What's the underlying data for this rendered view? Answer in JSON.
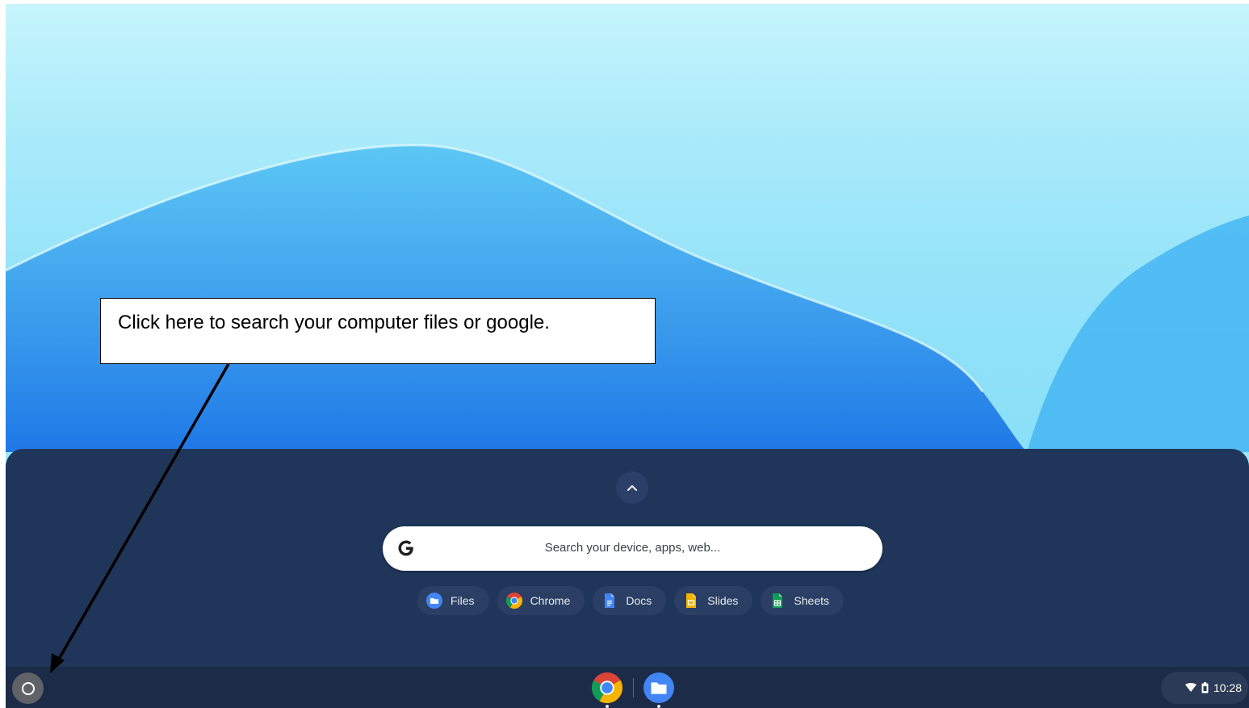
{
  "annotation": {
    "callout_text": "Click here to search your computer files or google."
  },
  "launcher": {
    "search": {
      "placeholder": "Search your device, apps, web..."
    },
    "suggested_apps": [
      {
        "label": "Files",
        "icon": "files-icon"
      },
      {
        "label": "Chrome",
        "icon": "chrome-icon"
      },
      {
        "label": "Docs",
        "icon": "docs-icon"
      },
      {
        "label": "Slides",
        "icon": "slides-icon"
      },
      {
        "label": "Sheets",
        "icon": "sheets-icon"
      }
    ],
    "expand_icon": "chevron-up-icon"
  },
  "shelf": {
    "launcher_icon": "launcher-circle-icon",
    "pinned_apps": [
      {
        "name": "Chrome",
        "icon": "chrome-icon"
      },
      {
        "name": "Files",
        "icon": "files-icon"
      }
    ],
    "status": {
      "time": "10:28",
      "icons": [
        "wifi-icon",
        "battery-icon"
      ]
    }
  },
  "colors": {
    "launcher_bg": "#1f3559",
    "shelf_bg": "#1c2b47",
    "chip_bg": "#2a3f63",
    "files_blue": "#4285f4",
    "docs_blue": "#4285f4",
    "slides_yellow": "#f4b400",
    "sheets_green": "#0f9d58"
  }
}
